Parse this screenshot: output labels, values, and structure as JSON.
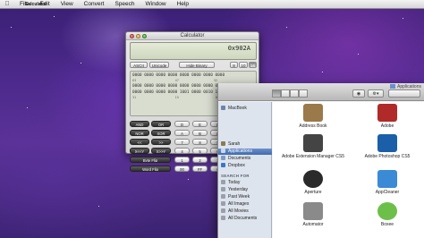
{
  "menubar": {
    "apple_icon": "apple-icon",
    "items": [
      "Calculator",
      "File",
      "Edit",
      "View",
      "Convert",
      "Speech",
      "Window",
      "Help"
    ]
  },
  "calculator": {
    "title": "Calculator",
    "display": "0x902A",
    "modes": {
      "ascii": "ASCII",
      "unicode": "Unicode",
      "hide_binary": "Hide Binary",
      "base8": "8",
      "base10": "10",
      "base16": "16",
      "selected_base": "16"
    },
    "binary": [
      "0000 0000 0000 0000 0000 0000 0000 0000",
      "0000 0000 0000 0000 0000 0000 0000 0000",
      "0000 0000 0000 0000 1001 0000 0010 1010"
    ],
    "bit_index": [
      "63                    47                  32",
      "31                    15                   0"
    ],
    "keys": {
      "and": "AND",
      "or": "OR",
      "d": "D",
      "e": "E",
      "f": "F",
      "ac": "AC",
      "c": "C",
      "nor": "NOR",
      "xor": "XOR",
      "a": "A",
      "b": "B",
      "c_hex": "C",
      "sign": "+/-",
      "divide": "÷",
      "shl": "<<",
      "shr": ">>",
      "k7": "7",
      "k8": "8",
      "k9": "9",
      "x_pow": "x",
      "xshl": "X<<Y",
      "xshr": "X>>Y",
      "k4": "4",
      "k5": "5",
      "k6": "6",
      "rol": "RoL",
      "ror": "RoR",
      "byte_flip": "Byte Flip",
      "k1": "1",
      "k2": "2",
      "k3": "3",
      "twos": "2's",
      "ones": "1's",
      "word_flip": "Word Flip",
      "k00": "00",
      "kff": "FF",
      "k0": "0",
      "equals": "="
    }
  },
  "finder": {
    "title": "Applications",
    "sidebar": {
      "macbook": "MacBook",
      "places": [
        "Sarah",
        "Applications",
        "Documents",
        "Dropbox"
      ],
      "search_header": "SEARCH FOR",
      "searches": [
        "Today",
        "Yesterday",
        "Past Week",
        "All Images",
        "All Movies",
        "All Documents"
      ]
    },
    "apps": [
      {
        "name": "Address Book",
        "color": "#9a7a4a"
      },
      {
        "name": "Adobe",
        "color": "#b02a2a"
      },
      {
        "name": "Adobe Extension Manager CS5",
        "color": "#444444"
      },
      {
        "name": "Adobe Photoshop CS5",
        "color": "#1a5fa8"
      },
      {
        "name": "Aperture",
        "color": "#2a2a2a"
      },
      {
        "name": "AppCleaner",
        "color": "#3a8ad6"
      },
      {
        "name": "Automator",
        "color": "#8a8a8a"
      },
      {
        "name": "Boxee",
        "color": "#6cc04a"
      }
    ]
  }
}
